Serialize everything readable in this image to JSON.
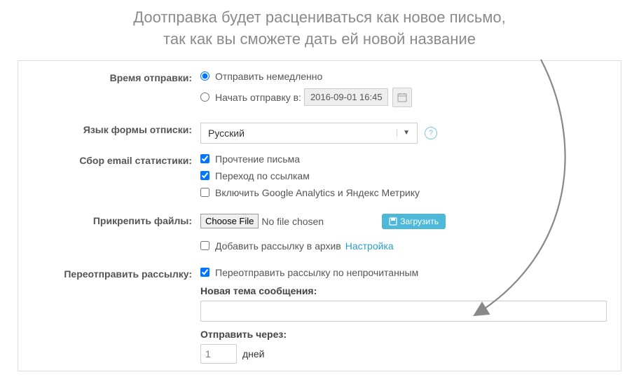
{
  "annotation": {
    "line1": "Доотправка будет расцениваться как новое письмо,",
    "line2": "так как вы сможете дать ей новой название"
  },
  "form": {
    "send_time": {
      "label": "Время отправки:",
      "option_now": "Отправить немедленно",
      "option_scheduled": "Начать отправку в:",
      "scheduled_value": "2016-09-01 16:45"
    },
    "unsubscribe_lang": {
      "label": "Язык формы отписки:",
      "selected": "Русский"
    },
    "stats": {
      "label": "Сбор email статистики:",
      "opt_read": "Прочтение письма",
      "opt_links": "Переход по ссылкам",
      "opt_ga": "Включить Google Analytics и Яндекс Метрику"
    },
    "attach": {
      "label": "Прикрепить файлы:",
      "choose_btn": "Choose File",
      "no_file": "No file chosen",
      "upload_btn": "Загрузить",
      "archive_text": "Добавить рассылку в архив",
      "archive_link": "Настройка"
    },
    "resend": {
      "label": "Переотправить рассылку:",
      "check_text": "Переотправить рассылку по непрочитанным",
      "new_subject_label": "Новая тема сообщения:",
      "send_after_label": "Отправить через:",
      "days_placeholder": "1",
      "days_unit": "дней"
    }
  }
}
